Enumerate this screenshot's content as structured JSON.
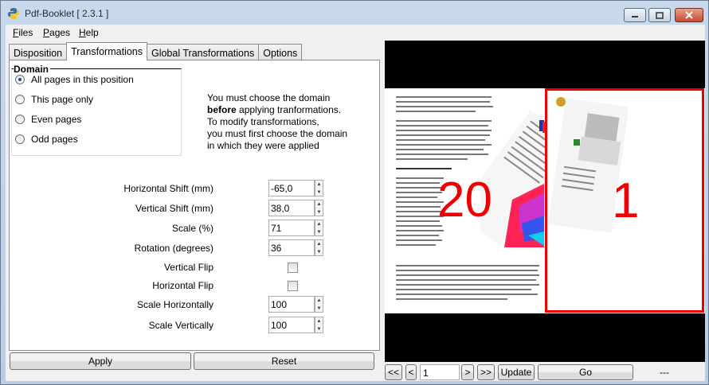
{
  "window": {
    "title": "Pdf-Booklet  [ 2.3.1 ]"
  },
  "menu": [
    {
      "label": "Files",
      "mnemonic": "F",
      "rest": "iles"
    },
    {
      "label": "Pages",
      "mnemonic": "P",
      "rest": "ages"
    },
    {
      "label": "Help",
      "mnemonic": "H",
      "rest": "elp"
    }
  ],
  "tabs": [
    "Disposition",
    "Transformations",
    "Global Transformations",
    "Options"
  ],
  "active_tab": "Transformations",
  "domain": {
    "title": "Domain",
    "options": [
      "All pages in this position",
      "This page only",
      "Even pages",
      "Odd pages"
    ],
    "selected": "All pages in this position"
  },
  "info": {
    "line1": "You must choose the domain",
    "line2_bold": "before",
    "line2_rest": " applying tranformations.",
    "line3": "To modify transformations,",
    "line4": "you must first choose the domain",
    "line5": "in which they were applied"
  },
  "fields": {
    "hshift_label": "Horizontal Shift (mm)",
    "hshift_value": "-65,0",
    "vshift_label": "Vertical Shift (mm)",
    "vshift_value": "38,0",
    "scale_label": "Scale (%)",
    "scale_value": "71",
    "rotation_label": "Rotation (degrees)",
    "rotation_value": "36",
    "vflip_label": "Vertical Flip",
    "vflip_checked": false,
    "hflip_label": "Horizontal Flip",
    "hflip_checked": false,
    "scaleh_label": "Scale Horizontally",
    "scaleh_value": "100",
    "scalev_label": "Scale Vertically",
    "scalev_value": "100"
  },
  "buttons": {
    "apply": "Apply",
    "reset": "Reset"
  },
  "preview": {
    "left_page_number": "20",
    "right_page_number": "1",
    "frame_color": "#e00000"
  },
  "nav": {
    "first": "<<",
    "prev": "<",
    "page_value": "1",
    "next": ">",
    "last": ">>",
    "update": "Update",
    "go": "Go",
    "status": "---"
  }
}
